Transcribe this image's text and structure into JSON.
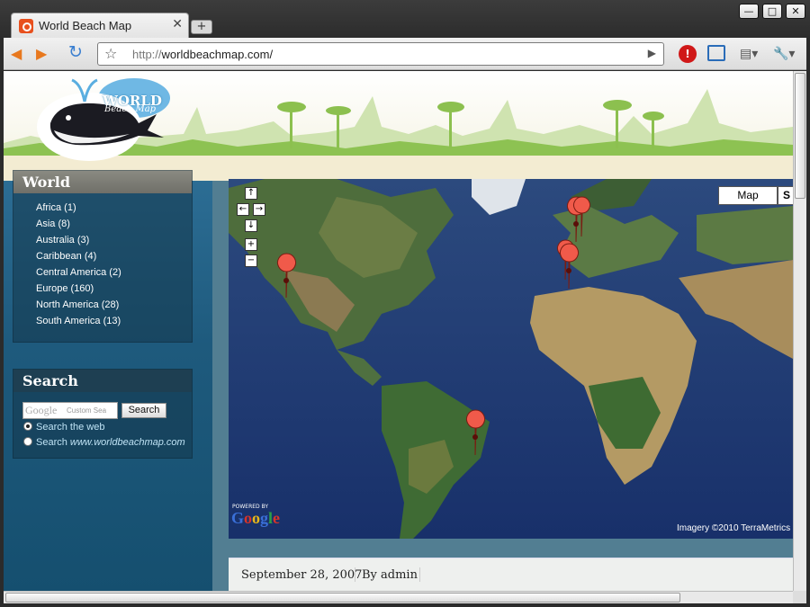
{
  "tab": {
    "title": "World Beach Map",
    "close": "✕",
    "new_tab": "+"
  },
  "window_buttons": {
    "minimize": "—",
    "maximize": "□",
    "close": "✕"
  },
  "toolbar": {
    "back": "◀",
    "forward": "▶",
    "reload": "↻",
    "url_prefix": "http://",
    "url_host": "worldbeachmap.com/",
    "star": "☆",
    "go": "▶",
    "stop": "!",
    "page": "▤▾",
    "wrench": "🔧▾"
  },
  "logo": {
    "title": "WORLD",
    "subtitle": "Beach Map"
  },
  "world_widget": {
    "title": "World",
    "items": [
      "Africa (1)",
      "Asia (8)",
      "Australia (3)",
      "Caribbean (4)",
      "Central America (2)",
      "Europe (160)",
      "North America (28)",
      "South America (13)"
    ]
  },
  "search_widget": {
    "title": "Search",
    "google": "Google",
    "placeholder": "Custom Sea",
    "button": "Search",
    "option_web": "Search the web",
    "option_site_prefix": "Search ",
    "option_site": "www.worldbeachmap.com"
  },
  "map": {
    "pan_up": "↑",
    "pan_left": "←",
    "pan_right": "→",
    "pan_down": "↓",
    "zoom_in": "+",
    "zoom_out": "−",
    "type_map": "Map",
    "type_satellite": "S",
    "powered_by": "POWERED BY",
    "google": "Google",
    "credit": "Imagery ©2010 TerraMetrics"
  },
  "post": {
    "date": "September 28, 2007",
    "author": "By admin"
  },
  "colors": {
    "marker": "#f05a4a",
    "link": "#bfe3f5",
    "sidebar": "#1e5a7d"
  }
}
